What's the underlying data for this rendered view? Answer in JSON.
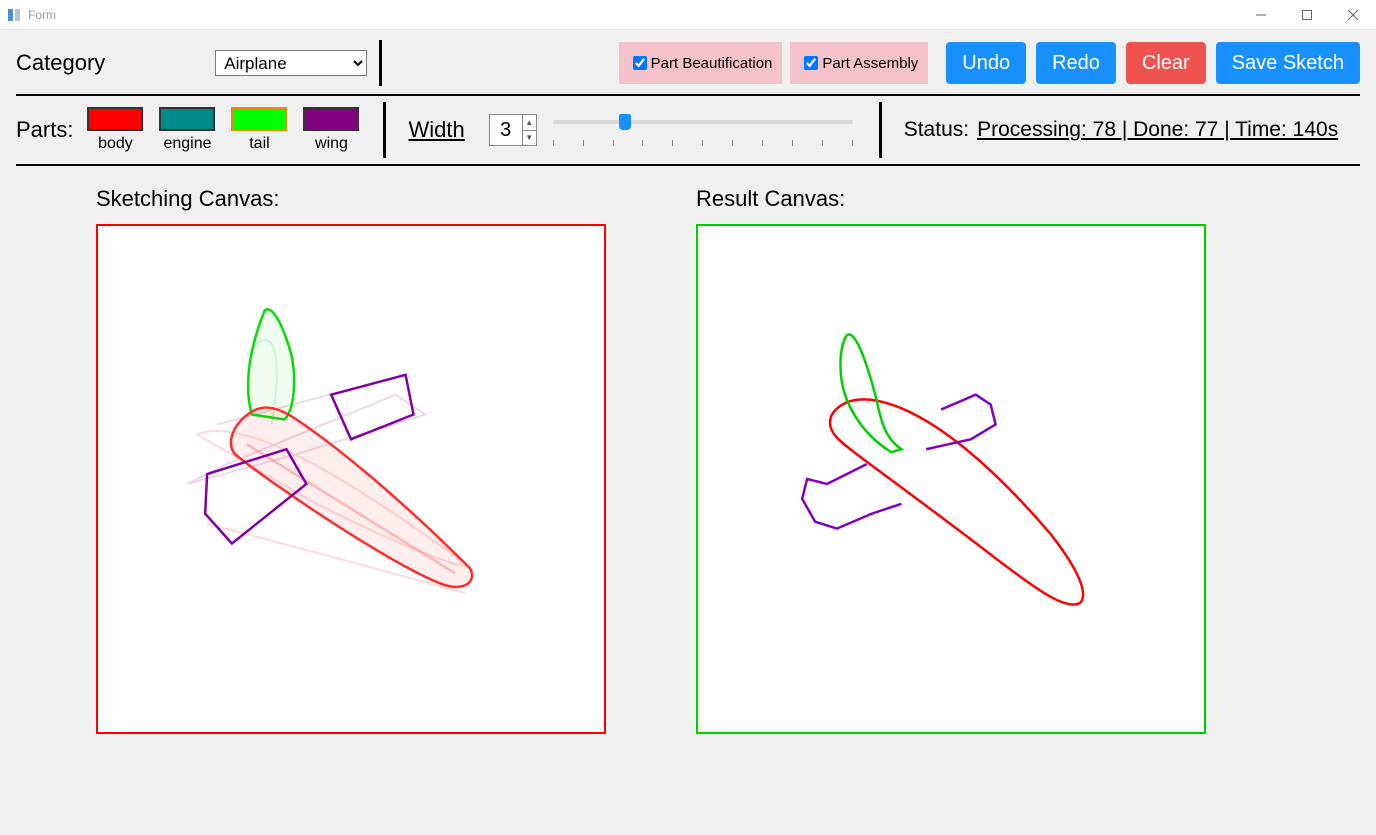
{
  "window": {
    "title": "Form"
  },
  "category": {
    "label": "Category",
    "selected": "Airplane",
    "options": [
      "Airplane"
    ]
  },
  "checkboxes": {
    "beautification": {
      "label": "Part Beautification",
      "checked": true
    },
    "assembly": {
      "label": "Part Assembly",
      "checked": true
    }
  },
  "buttons": {
    "undo": "Undo",
    "redo": "Redo",
    "clear": "Clear",
    "save": "Save Sketch"
  },
  "parts": {
    "label": "Parts:",
    "items": [
      {
        "name": "body",
        "color": "#ff0000",
        "selected": false
      },
      {
        "name": "engine",
        "color": "#008b8b",
        "selected": false
      },
      {
        "name": "tail",
        "color": "#00ff00",
        "selected": true
      },
      {
        "name": "wing",
        "color": "#800080",
        "selected": false
      }
    ]
  },
  "width": {
    "label": "Width",
    "value": "3",
    "slider_pos_pct": 22
  },
  "status": {
    "label": "Status:",
    "text": "Processing: 78 | Done: 77 | Time: 140s"
  },
  "canvas_labels": {
    "sketch": "Sketching Canvas:",
    "result": "Result Canvas:"
  }
}
